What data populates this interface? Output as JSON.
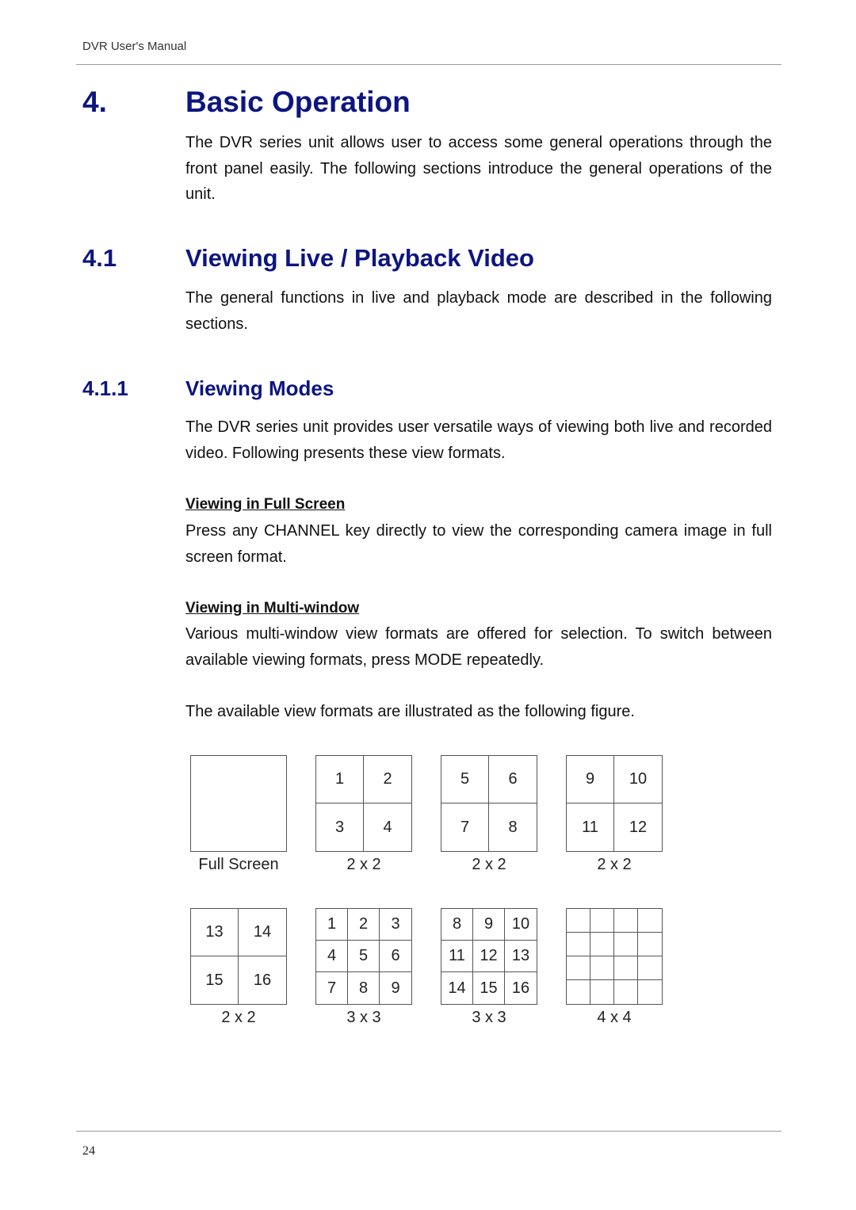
{
  "header": {
    "running_title": "DVR User's Manual"
  },
  "chapter": {
    "number": "4.",
    "title": "Basic Operation",
    "intro": "The DVR series unit allows user to access some general operations through the front panel easily. The following sections introduce the general operations of the unit."
  },
  "section": {
    "number": "4.1",
    "title": "Viewing Live / Playback Video",
    "intro": "The general functions in live and playback mode are described in the following sections."
  },
  "subsection": {
    "number": "4.1.1",
    "title": "Viewing Modes",
    "intro": "The DVR series unit provides user versatile ways of viewing both live and recorded video. Following presents these view formats."
  },
  "full_screen": {
    "heading": "Viewing in Full Screen",
    "body": "Press any CHANNEL key directly to view the corresponding camera image in full screen format."
  },
  "multi_window": {
    "heading": "Viewing in Multi-window",
    "body": "Various multi-window view formats are offered for selection. To switch between available viewing formats, press MODE repeatedly.",
    "figure_intro": "The available view formats are illustrated as the following figure."
  },
  "figure": {
    "formats": [
      {
        "caption": "Full Screen",
        "cells": []
      },
      {
        "caption": "2 x 2",
        "cells": [
          "1",
          "2",
          "3",
          "4"
        ]
      },
      {
        "caption": "2 x 2",
        "cells": [
          "5",
          "6",
          "7",
          "8"
        ]
      },
      {
        "caption": "2 x 2",
        "cells": [
          "9",
          "10",
          "11",
          "12"
        ]
      },
      {
        "caption": "2 x 2",
        "cells": [
          "13",
          "14",
          "15",
          "16"
        ]
      },
      {
        "caption": "3 x 3",
        "cells": [
          "1",
          "2",
          "3",
          "4",
          "5",
          "6",
          "7",
          "8",
          "9"
        ]
      },
      {
        "caption": "3 x 3",
        "cells": [
          "8",
          "9",
          "10",
          "11",
          "12",
          "13",
          "14",
          "15",
          "16"
        ]
      },
      {
        "caption": "4 x 4",
        "cells": [
          "",
          "",
          "",
          "",
          "",
          "",
          "",
          "",
          "",
          "",
          "",
          "",
          "",
          "",
          "",
          ""
        ]
      }
    ]
  },
  "footer": {
    "page_number": "24"
  }
}
